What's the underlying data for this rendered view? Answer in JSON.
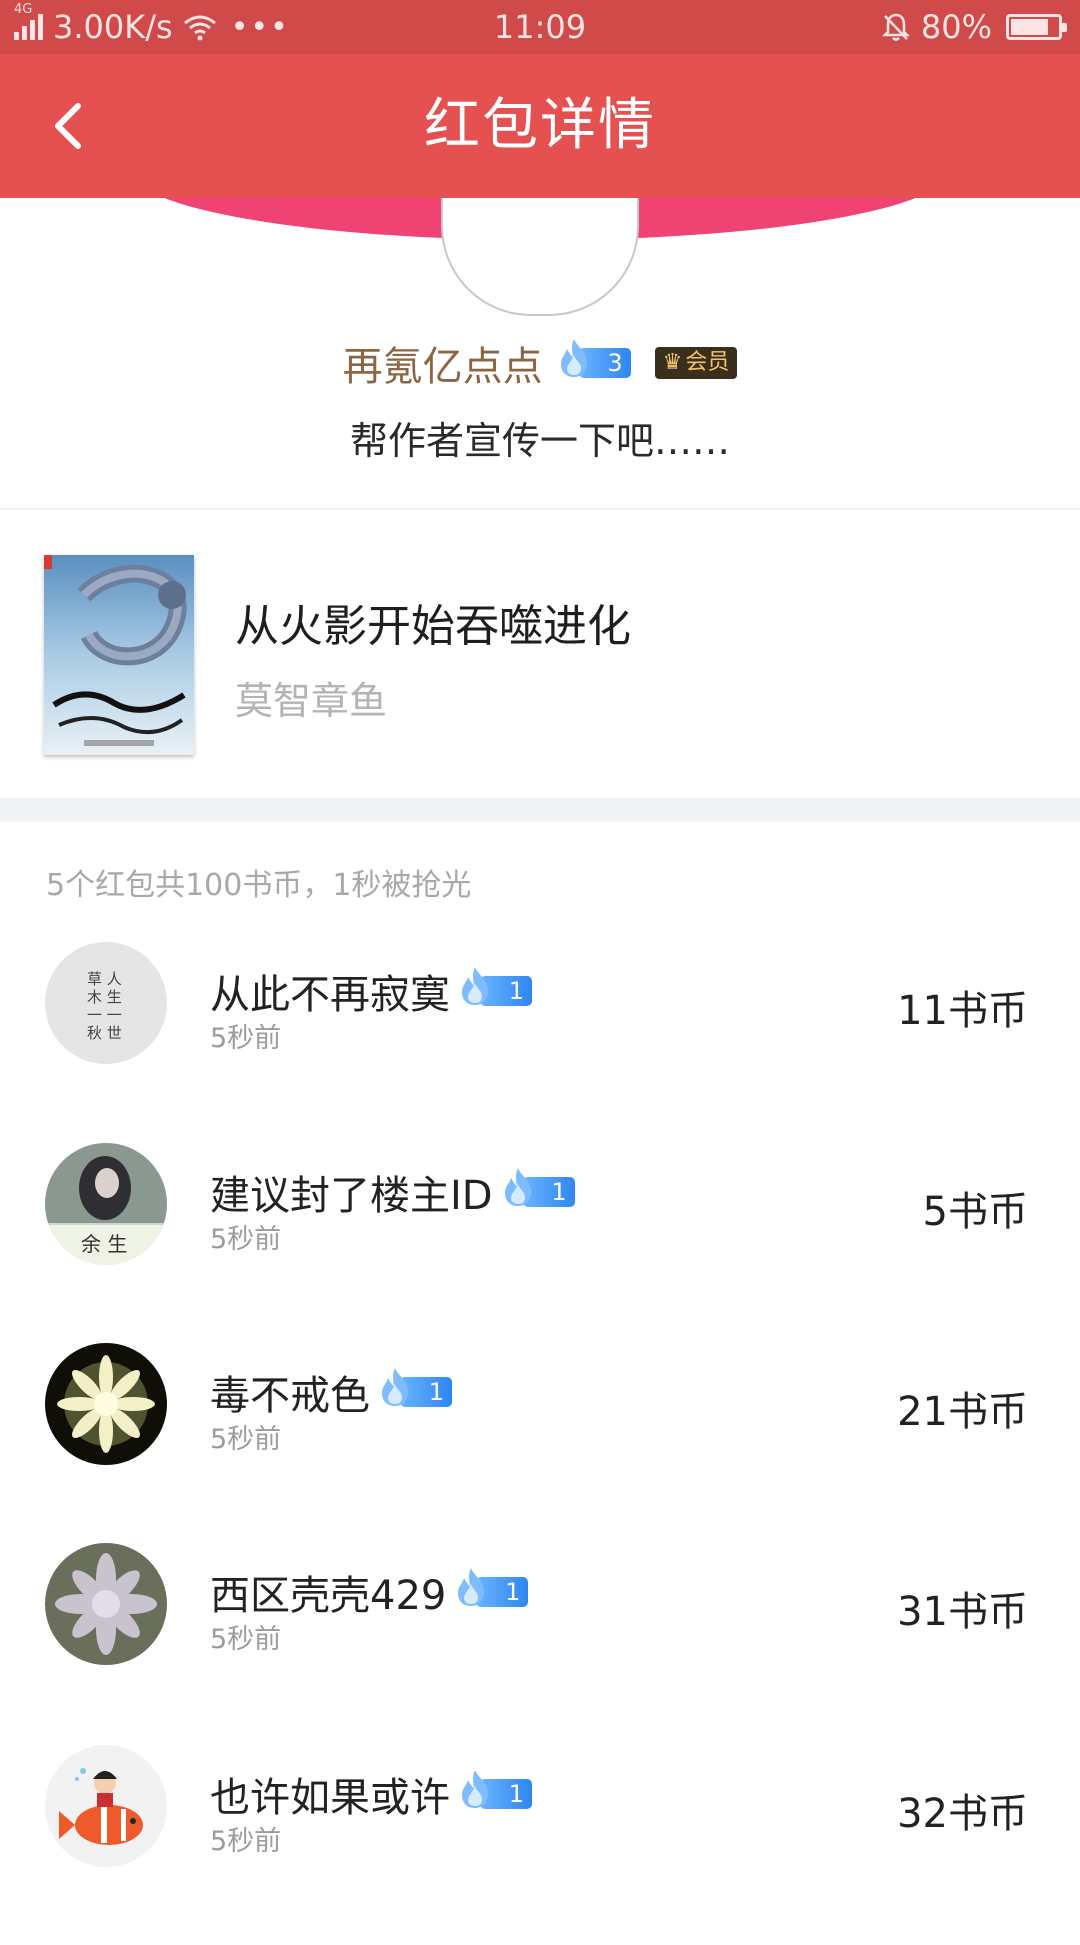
{
  "status_bar": {
    "network_type": "4G",
    "speed": "3.00K/s",
    "more": "•••",
    "time": "11:09",
    "battery_percent": "80%",
    "battery_level": 0.8
  },
  "header": {
    "title": "红包详情",
    "back_icon": "chevron-left-icon"
  },
  "sender": {
    "name": "再氪亿点点",
    "level": "3",
    "vip_label": "会员",
    "message": "帮作者宣传一下吧……"
  },
  "book": {
    "title": "从火影开始吞噬进化",
    "author": "莫智章鱼"
  },
  "summary": "5个红包共100书币，1秒被抢光",
  "records": [
    {
      "name": "从此不再寂寞",
      "level": "1",
      "time": "5秒前",
      "amount": "11书币"
    },
    {
      "name": "建议封了楼主ID",
      "level": "1",
      "time": "5秒前",
      "amount": "5书币"
    },
    {
      "name": "毒不戒色",
      "level": "1",
      "time": "5秒前",
      "amount": "21书币"
    },
    {
      "name": "西区壳壳429",
      "level": "1",
      "time": "5秒前",
      "amount": "31书币"
    },
    {
      "name": "也许如果或许",
      "level": "1",
      "time": "5秒前",
      "amount": "32书币"
    }
  ],
  "colors": {
    "title_bar": "#e55050",
    "status_bar": "#cf4a48",
    "arc": "#ef4473",
    "sender_name": "#8c6543",
    "badge_blue": "#2e86f0"
  }
}
